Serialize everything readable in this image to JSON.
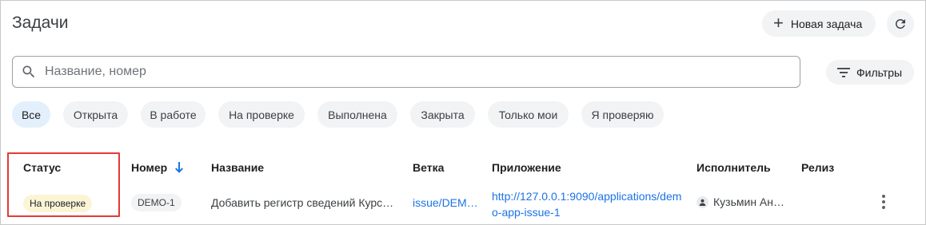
{
  "page": {
    "title": "Задачи"
  },
  "toolbar": {
    "new_task_label": "Новая задача",
    "filters_label": "Фильтры"
  },
  "search": {
    "placeholder": "Название, номер",
    "value": ""
  },
  "chips": [
    {
      "label": "Все",
      "active": true
    },
    {
      "label": "Открыта",
      "active": false
    },
    {
      "label": "В работе",
      "active": false
    },
    {
      "label": "На проверке",
      "active": false
    },
    {
      "label": "Выполнена",
      "active": false
    },
    {
      "label": "Закрыта",
      "active": false
    },
    {
      "label": "Только мои",
      "active": false
    },
    {
      "label": "Я проверяю",
      "active": false
    }
  ],
  "table": {
    "columns": {
      "status": "Статус",
      "number": "Номер",
      "name": "Название",
      "branch": "Ветка",
      "app": "Приложение",
      "assignee": "Исполнитель",
      "release": "Релиз"
    },
    "sort": {
      "column": "number",
      "direction": "desc"
    },
    "rows": [
      {
        "status": "На проверке",
        "number": "DEMO-1",
        "name": "Добавить регистр сведений Курс…",
        "branch": "issue/DEM…",
        "app": "http://127.0.0.1:9090/applications/demo-app-issue-1",
        "assignee": "Кузьмин Ан…",
        "release": ""
      }
    ]
  },
  "colors": {
    "accent": "#1a73e8",
    "chip_bg": "#f1f3f4",
    "chip_active_bg": "#e3f0fc",
    "status_review_bg": "#fbf5d6",
    "highlight": "#e53935"
  },
  "icons": {
    "plus": "plus-icon",
    "refresh": "refresh-icon",
    "search": "search-icon",
    "filter": "filter-icon",
    "sort": "arrow-down-icon",
    "avatar": "person-icon",
    "more": "more-vert-icon"
  }
}
